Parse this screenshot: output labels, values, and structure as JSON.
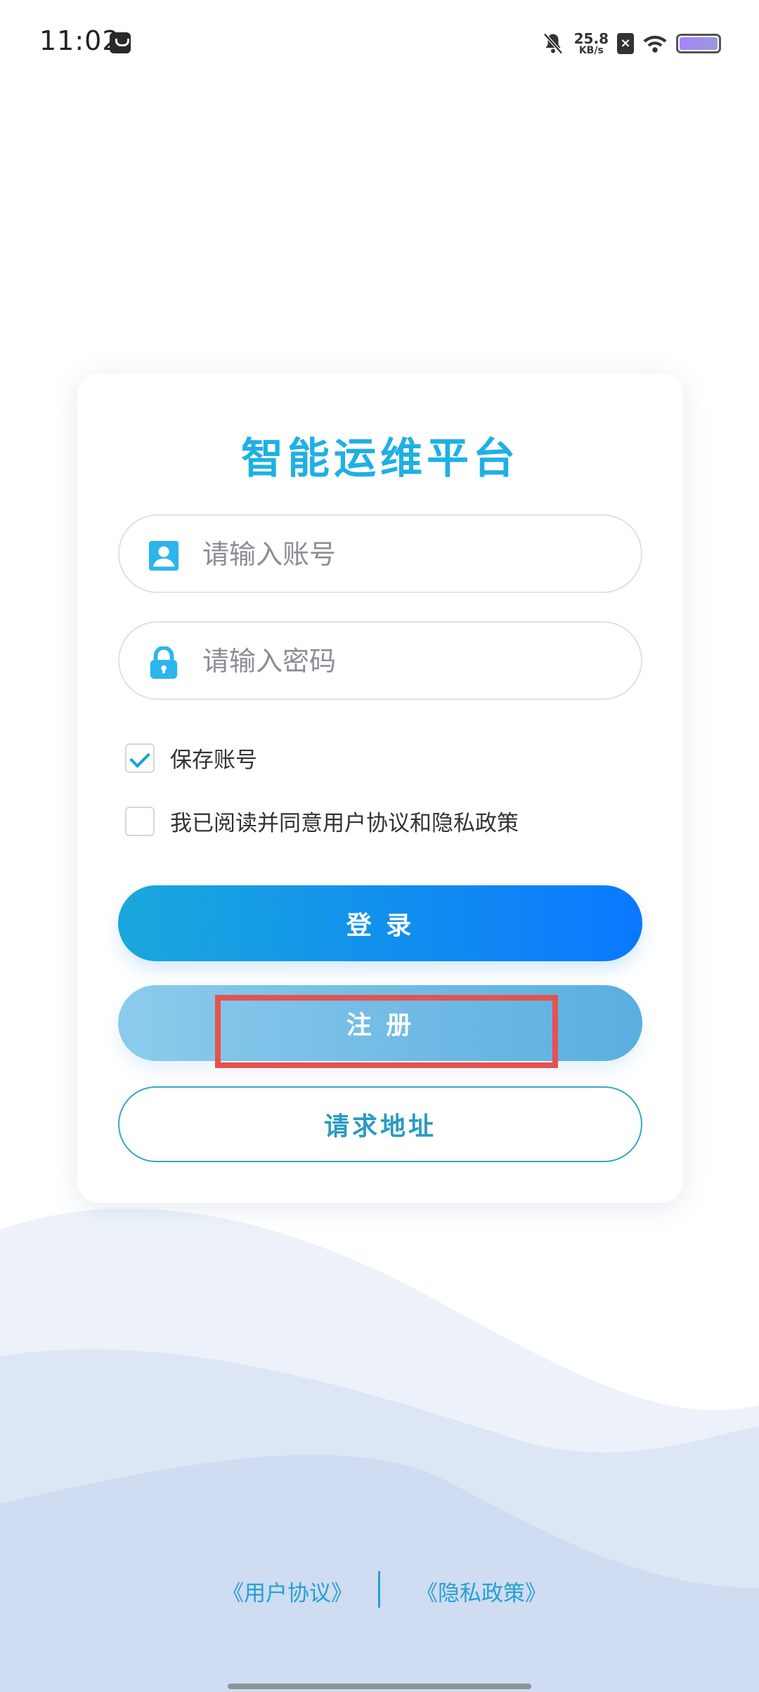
{
  "status_bar": {
    "time": "11:02",
    "net_speed_value": "25.8",
    "net_speed_unit": "KB/s",
    "sim_badge": "×"
  },
  "login": {
    "title": "智能运维平台",
    "account_placeholder": "请输入账号",
    "password_placeholder": "请输入密码",
    "save_account_label": "保存账号",
    "save_account_checked": true,
    "agree_label": "我已阅读并同意用户协议和隐私政策",
    "agree_checked": false,
    "login_button": "登 录",
    "register_button": "注 册",
    "address_button": "请求地址"
  },
  "footer": {
    "user_agreement": "《用户协议》",
    "privacy_policy": "《隐私政策》"
  },
  "colors": {
    "accent": "#1fb0e3",
    "login_gradient": [
      "#1aa8db",
      "#0a78ff"
    ],
    "register_gradient": [
      "#8ccbec",
      "#5aaee0"
    ],
    "highlight": "#e5524f"
  }
}
